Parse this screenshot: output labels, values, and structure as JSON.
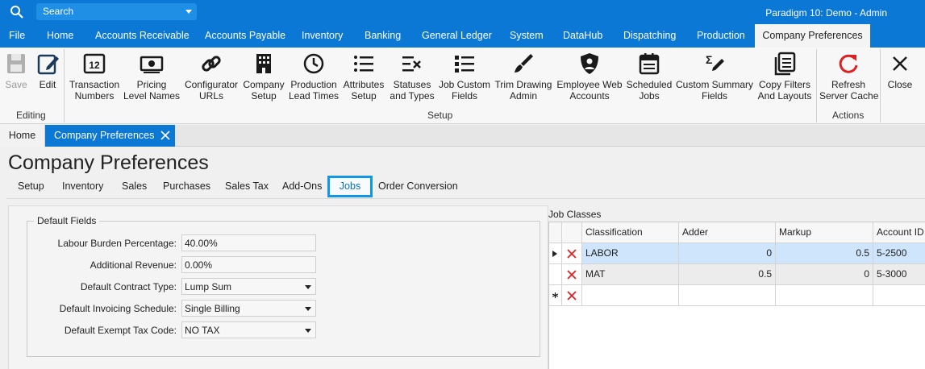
{
  "titlebar": {
    "search_placeholder": "Search",
    "app_title": "Paradigm 10: Demo - Admin"
  },
  "menu": [
    {
      "label": "File"
    },
    {
      "label": "Home"
    },
    {
      "label": "Accounts Receivable"
    },
    {
      "label": "Accounts Payable"
    },
    {
      "label": "Inventory"
    },
    {
      "label": "Banking"
    },
    {
      "label": "General Ledger"
    },
    {
      "label": "System"
    },
    {
      "label": "DataHub"
    },
    {
      "label": "Dispatching"
    },
    {
      "label": "Production"
    },
    {
      "label": "Company Preferences",
      "active": true
    }
  ],
  "ribbon": {
    "editing": {
      "label": "Editing",
      "save_label": "Save",
      "edit_label": "Edit"
    },
    "setup": {
      "label": "Setup",
      "buttons": [
        {
          "label": "Transaction\nNumbers"
        },
        {
          "label": "Pricing\nLevel Names"
        },
        {
          "label": "Configurator\nURLs"
        },
        {
          "label": "Company\nSetup"
        },
        {
          "label": "Production\nLead Times"
        },
        {
          "label": "Attributes\nSetup"
        },
        {
          "label": "Statuses\nand Types"
        },
        {
          "label": "Job Custom\nFields"
        },
        {
          "label": "Trim Drawing\nAdmin"
        },
        {
          "label": "Employee Web\nAccounts"
        },
        {
          "label": "Scheduled\nJobs"
        },
        {
          "label": "Custom Summary\nFields"
        },
        {
          "label": "Copy Filters\nAnd Layouts"
        }
      ]
    },
    "actions": {
      "label": "Actions",
      "refresh_label": "Refresh\nServer Cache"
    },
    "close_label": "Close"
  },
  "doctabs": {
    "home": "Home",
    "company_prefs": "Company Preferences"
  },
  "page": {
    "title": "Company Preferences",
    "subtabs": [
      {
        "label": "Setup"
      },
      {
        "label": "Inventory"
      },
      {
        "label": "Sales"
      },
      {
        "label": "Purchases"
      },
      {
        "label": "Sales Tax"
      },
      {
        "label": "Add-Ons"
      },
      {
        "label": "Jobs",
        "active": true
      },
      {
        "label": "Order Conversion"
      }
    ]
  },
  "default_fields": {
    "legend": "Default Fields",
    "rows": [
      {
        "label": "Labour Burden Percentage:",
        "value": "40.00%",
        "dropdown": false
      },
      {
        "label": "Additional Revenue:",
        "value": "0.00%",
        "dropdown": false
      },
      {
        "label": "Default Contract Type:",
        "value": "Lump Sum",
        "dropdown": true
      },
      {
        "label": "Default Invoicing Schedule:",
        "value": "Single Billing",
        "dropdown": true
      },
      {
        "label": "Default Exempt Tax Code:",
        "value": "NO TAX",
        "dropdown": true
      }
    ]
  },
  "job_classes": {
    "title": "Job Classes",
    "columns": [
      "Classification",
      "Adder",
      "Markup",
      "Account ID"
    ],
    "rows": [
      {
        "classification": "LABOR",
        "adder": "0",
        "markup": "0.5",
        "account_id": "5-2500"
      },
      {
        "classification": "MAT",
        "adder": "0.5",
        "markup": "0",
        "account_id": "5-3000"
      }
    ]
  },
  "colors": {
    "brand_blue": "#0a78d4",
    "delete_red": "#e02020",
    "refresh_red": "#e02020",
    "selected_row": "#cfe5fb"
  }
}
